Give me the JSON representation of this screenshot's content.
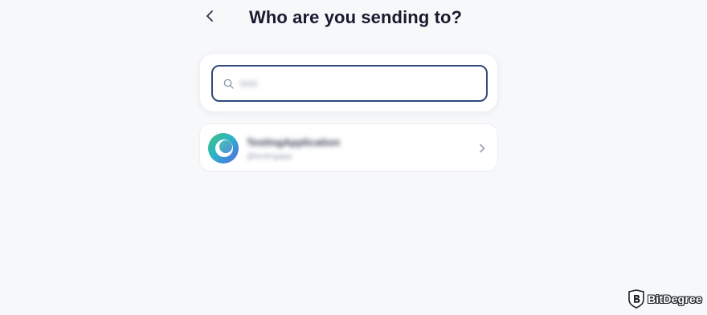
{
  "header": {
    "title": "Who are you sending to?",
    "back_icon": "chevron-left-icon"
  },
  "search": {
    "value": "test",
    "icon": "search-icon"
  },
  "results": [
    {
      "name": "TestingApplication",
      "handle": "@testingapp",
      "avatar_colors": [
        "#3fc27a",
        "#2db4c7",
        "#5467e6"
      ],
      "trailing_icon": "chevron-right-icon"
    }
  ],
  "watermark": {
    "text": "BitDegree",
    "icon": "bitdegree-logo"
  },
  "colors": {
    "background": "#f7f8fa",
    "search_border": "#2f4a78",
    "title": "#161a2e"
  }
}
